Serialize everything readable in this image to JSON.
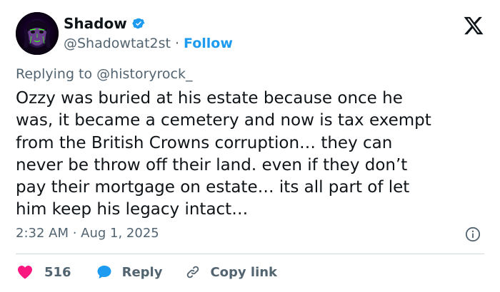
{
  "author": {
    "display_name": "Shadow",
    "handle": "@Shadowtat2st",
    "separator": "·",
    "follow_label": "Follow",
    "verified": true
  },
  "brand": {
    "logo_icon": "x-logo-icon"
  },
  "reply_context": {
    "prefix": "Replying to ",
    "handle": "@historyrock_"
  },
  "tweet": {
    "text": "Ozzy was buried at his estate because once he\nwas, it became a cemetery and now is tax exempt\nfrom the British Crowns corruption… they can\nnever be throw off their land. even if they don’t\npay their mortgage on estate… its all part of let\nhim keep his legacy intact…"
  },
  "meta": {
    "time": "2:32 AM",
    "separator": " · ",
    "date": "Aug 1, 2025",
    "info_icon": "info-icon"
  },
  "actions": {
    "like_count": "516",
    "reply_label": "Reply",
    "copy_link_label": "Copy link"
  },
  "colors": {
    "accent": "#1d9bf0",
    "like": "#f91880",
    "text_primary": "#0f1419",
    "text_secondary": "#536471",
    "divider": "#cfd9de"
  }
}
